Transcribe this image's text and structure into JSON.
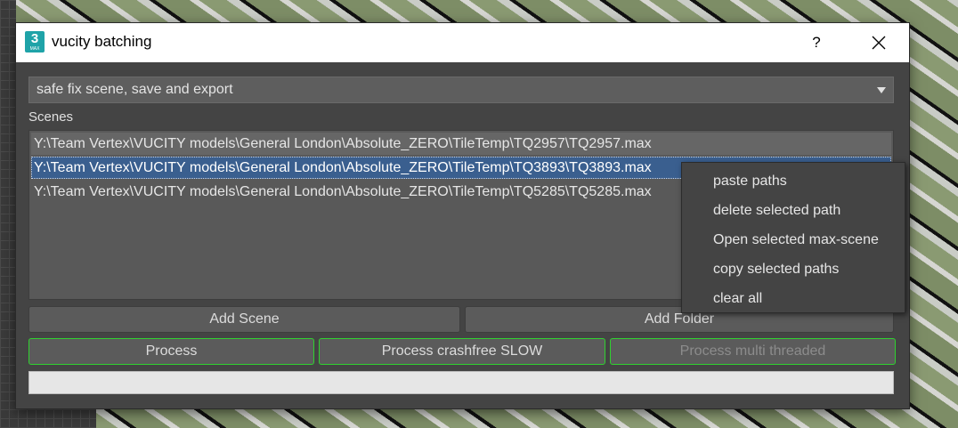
{
  "window": {
    "title": "vucity batching",
    "icon_text": "3",
    "icon_subtext": "MAX",
    "help_label": "?",
    "close_icon": "close-icon"
  },
  "combo": {
    "selected": "safe fix scene, save and export"
  },
  "scenes": {
    "label": "Scenes",
    "items": [
      "Y:\\Team Vertex\\VUCITY models\\General London\\Absolute_ZERO\\TileTemp\\TQ2957\\TQ2957.max",
      "Y:\\Team Vertex\\VUCITY models\\General London\\Absolute_ZERO\\TileTemp\\TQ3893\\TQ3893.max",
      "Y:\\Team Vertex\\VUCITY models\\General London\\Absolute_ZERO\\TileTemp\\TQ5285\\TQ5285.max"
    ],
    "selected_index": 1
  },
  "buttons": {
    "add_scene": "Add Scene",
    "add_folder": "Add Folder",
    "process": "Process",
    "process_crashfree": "Process crashfree SLOW",
    "process_multi": "Process multi threaded"
  },
  "progress": {
    "value": 0
  },
  "context_menu": {
    "items": [
      "paste paths",
      "delete selected path",
      "Open selected max-scene",
      "copy selected paths",
      "clear all"
    ]
  },
  "colors": {
    "accent_border": "#2fd12f",
    "selection": "#3a5f8f",
    "panel": "#444444"
  }
}
